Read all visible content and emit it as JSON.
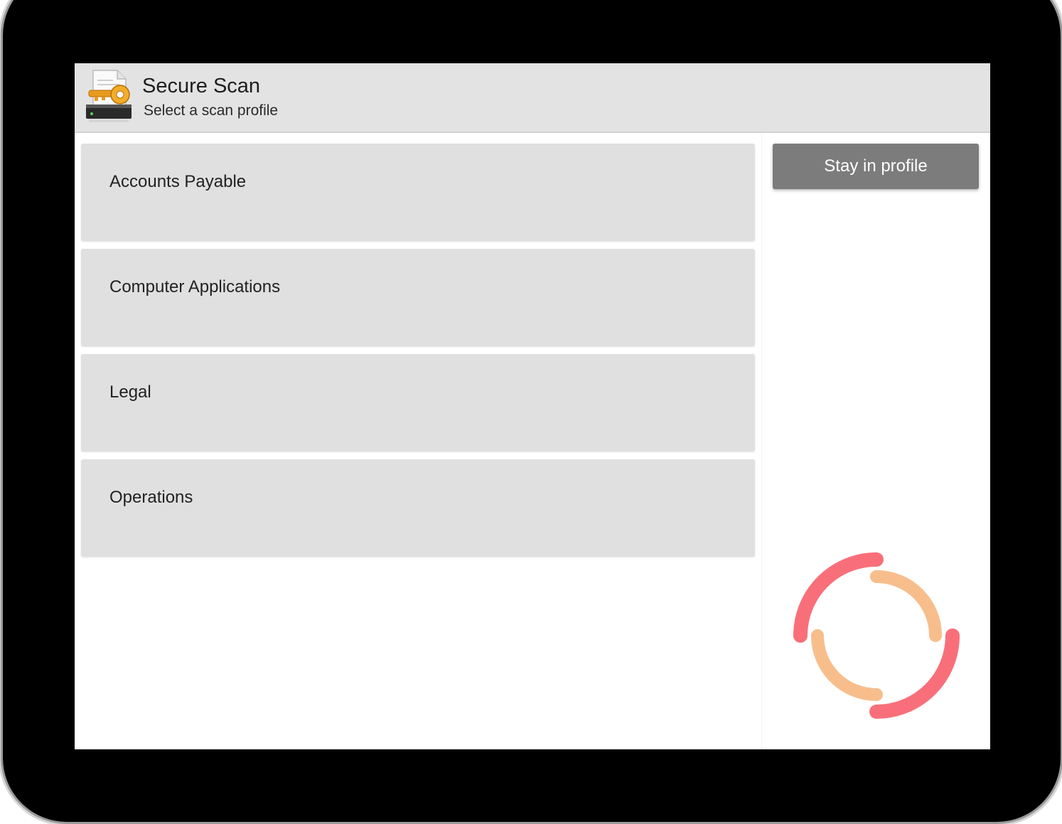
{
  "header": {
    "title": "Secure Scan",
    "subtitle": "Select a scan profile",
    "icon": "secure-scan-icon"
  },
  "profiles": [
    {
      "label": "Accounts Payable"
    },
    {
      "label": "Computer Applications"
    },
    {
      "label": "Legal"
    },
    {
      "label": "Operations"
    }
  ],
  "actions": {
    "stay_label": "Stay in profile"
  },
  "spinner": {
    "icon": "loading-spinner-icon",
    "outer_color": "#f86f7a",
    "inner_color": "#f7be8c"
  },
  "colors": {
    "header_bg": "#e3e3e3",
    "item_bg": "#e0e0e0",
    "button_bg": "#7c7c7c"
  }
}
